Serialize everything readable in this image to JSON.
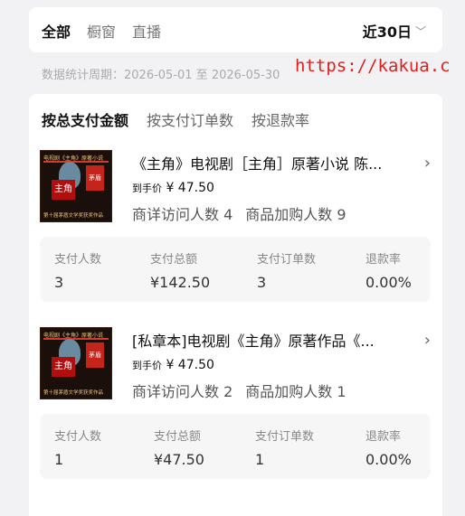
{
  "top_tabs": [
    "全部",
    "橱窗",
    "直播"
  ],
  "period": {
    "label": "近30日",
    "chevron_icon": "chevron-down-icon"
  },
  "stat_period": "数据统计周期：2026-05-01 至 2026-05-30",
  "watermark": "https://kakua.c",
  "sort_tabs": [
    "按总支付金额",
    "按支付订单数",
    "按退款率"
  ],
  "products": [
    {
      "title": "《主角》电视剧［主角］原著小说 陈...",
      "price_label": "到手价",
      "price": "¥ 47.50",
      "visitors": "商详访问人数 4",
      "cart": "商品加购人数 9",
      "thumb": {
        "top": "电视剧《主角》原著小说",
        "box": "主角",
        "seal": "茅盾",
        "bottom": "第十届茅盾文学奖获奖作品"
      },
      "stats": [
        {
          "label": "支付人数",
          "value": "3"
        },
        {
          "label": "支付总额",
          "value": "¥142.50"
        },
        {
          "label": "支付订单数",
          "value": "3"
        },
        {
          "label": "退款率",
          "value": "0.00%"
        }
      ]
    },
    {
      "title": "[私章本]电视剧《主角》原著作品《...",
      "price_label": "到手价",
      "price": "¥ 47.50",
      "visitors": "商详访问人数 2",
      "cart": "商品加购人数 1",
      "thumb": {
        "top": "电视剧《主角》原著小说",
        "box": "主角",
        "seal": "茅盾",
        "bottom": "第十届茅盾文学奖获奖作品"
      },
      "stats": [
        {
          "label": "支付人数",
          "value": "1"
        },
        {
          "label": "支付总额",
          "value": "¥47.50"
        },
        {
          "label": "支付订单数",
          "value": "1"
        },
        {
          "label": "退款率",
          "value": "0.00%"
        }
      ]
    }
  ]
}
